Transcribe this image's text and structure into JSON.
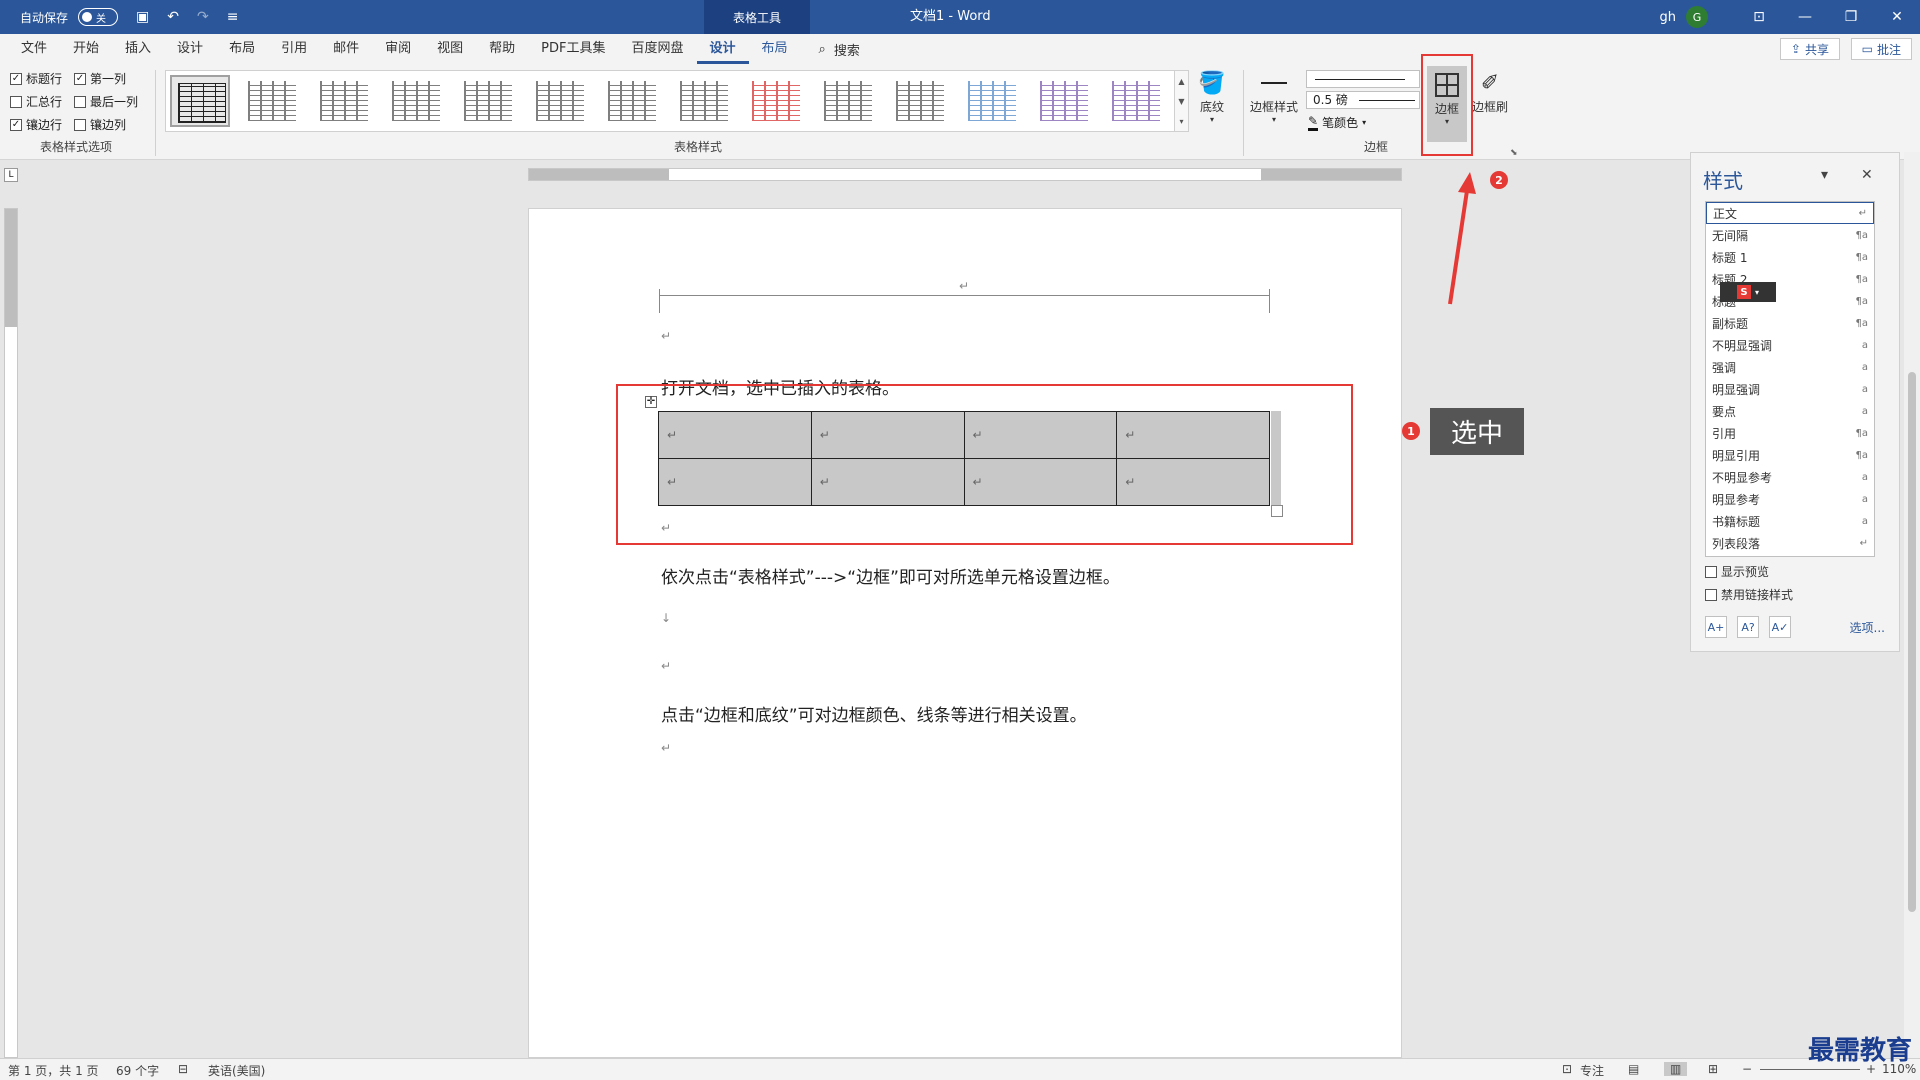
{
  "titlebar": {
    "autosave_label": "自动保存",
    "autosave_state": "关",
    "contextual_group": "表格工具",
    "doc_title": "文档1  -  Word",
    "user_name": "gh",
    "user_initial": "G"
  },
  "tabs": [
    "文件",
    "开始",
    "插入",
    "设计",
    "布局",
    "引用",
    "邮件",
    "审阅",
    "视图",
    "帮助",
    "PDF工具集",
    "百度网盘"
  ],
  "context_tabs": [
    "设计",
    "布局"
  ],
  "active_tab": "设计",
  "search_label": "搜索",
  "share_label": "共享",
  "comment_label": "批注",
  "ribbon": {
    "style_options": {
      "label": "表格样式选项",
      "items": [
        {
          "label": "标题行",
          "checked": true
        },
        {
          "label": "第一列",
          "checked": true
        },
        {
          "label": "汇总行",
          "checked": false
        },
        {
          "label": "最后一列",
          "checked": false
        },
        {
          "label": "镶边行",
          "checked": true
        },
        {
          "label": "镶边列",
          "checked": false
        }
      ]
    },
    "table_styles_label": "表格样式",
    "shading_label": "底纹",
    "border_styles_label": "边框样式",
    "line_weight": "0.5 磅",
    "pen_color_label": "笔颜色",
    "borders_label": "边框",
    "border_painter_label": "边框刷",
    "borders_group_label": "边框"
  },
  "document": {
    "para1": "打开文档，选中已插入的表格。",
    "para2": "依次点击“表格样式”--->“边框”即可对所选单元格设置边框。",
    "para3": "点击“边框和底纹”可对边框颜色、线条等进行相关设置。",
    "table": [
      [
        "↵",
        "↵",
        "↵",
        "↵"
      ],
      [
        "↵",
        "↵",
        "↵",
        "↵"
      ]
    ]
  },
  "annotations": {
    "badge1": "1",
    "badge2": "2",
    "callout": "选中"
  },
  "styles_pane": {
    "title": "样式",
    "items": [
      {
        "name": "正文",
        "sym": "↵"
      },
      {
        "name": "无间隔",
        "sym": "¶a"
      },
      {
        "name": "标题 1",
        "sym": "¶a"
      },
      {
        "name": "标题 2",
        "sym": "¶a"
      },
      {
        "name": "标题",
        "sym": "¶a"
      },
      {
        "name": "副标题",
        "sym": "¶a"
      },
      {
        "name": "不明显强调",
        "sym": "a"
      },
      {
        "name": "强调",
        "sym": "a"
      },
      {
        "name": "明显强调",
        "sym": "a"
      },
      {
        "name": "要点",
        "sym": "a"
      },
      {
        "name": "引用",
        "sym": "¶a"
      },
      {
        "name": "明显引用",
        "sym": "¶a"
      },
      {
        "name": "不明显参考",
        "sym": "a"
      },
      {
        "name": "明显参考",
        "sym": "a"
      },
      {
        "name": "书籍标题",
        "sym": "a"
      },
      {
        "name": "列表段落",
        "sym": "↵"
      }
    ],
    "show_preview": "显示预览",
    "disable_linked": "禁用链接样式",
    "options_link": "选项..."
  },
  "statusbar": {
    "page": "第 1 页，共 1 页",
    "words": "69 个字",
    "language": "英语(美国)",
    "focus": "专注",
    "zoom": "110%"
  },
  "watermark": "最需教育",
  "colors": {
    "accent": "#2b579a",
    "annotation_red": "#e53935"
  }
}
